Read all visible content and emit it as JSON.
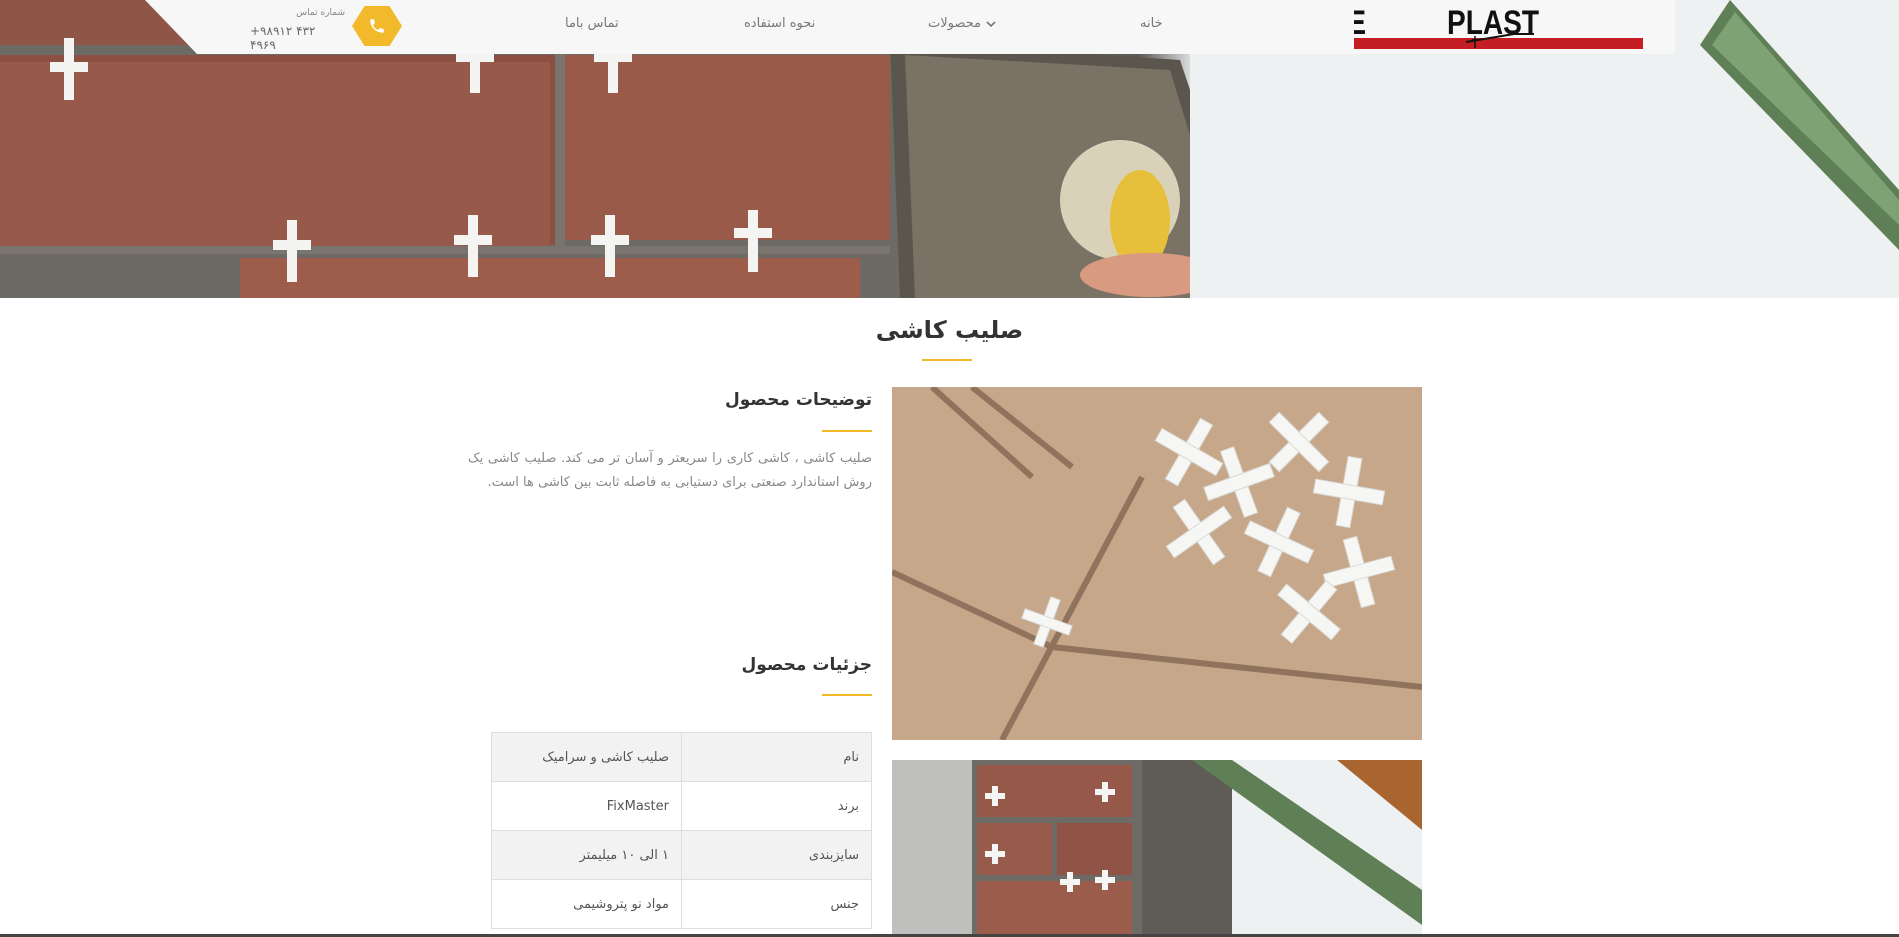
{
  "header": {
    "logo_text_left": "METRE",
    "logo_text_right": "PLAST",
    "nav": {
      "home": "خانه",
      "products": "محصولات",
      "usage": "نحوه استفاده",
      "contact": "تماس باما"
    },
    "phone": {
      "label": "شماره تماس",
      "number": "+۹۸۹۱۲ ۴۳۲ ۴۹۶۹",
      "icon": "phone-icon"
    }
  },
  "page": {
    "title": "صلیب کاشی"
  },
  "description": {
    "heading": "توضیحات محصول",
    "text": "صلیب کاشی ، کاشی کاری را سریعتر و آسان تر می کند. صلیب کاشی یک روش استاندارد صنعتی برای دستیابی به فاصله ثابت بین کاشی ها است."
  },
  "details": {
    "heading": "جزئیات محصول",
    "rows": [
      {
        "key": "نام",
        "value": "صلیب کاشی و سرامیک"
      },
      {
        "key": "برند",
        "value": "FixMaster"
      },
      {
        "key": "سایزبندی",
        "value": "۱ الی ۱۰ میلیمتر"
      },
      {
        "key": "جنس",
        "value": "مواد نو پتروشیمی"
      }
    ]
  },
  "colors": {
    "accent": "#f2b92b",
    "logo_red": "#c41e24",
    "text_muted": "#888888"
  }
}
